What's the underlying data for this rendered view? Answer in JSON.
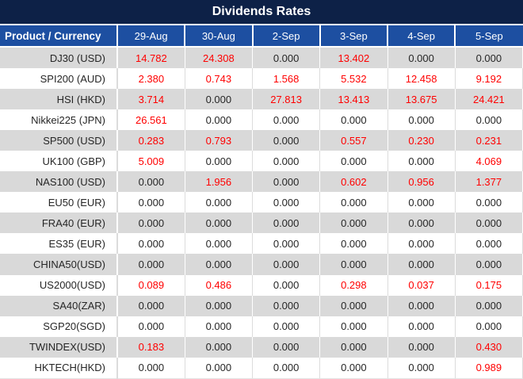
{
  "title": "Dividends Rates",
  "columns": [
    "Product / Currency",
    "29-Aug",
    "30-Aug",
    "2-Sep",
    "3-Sep",
    "4-Sep",
    "5-Sep"
  ],
  "rows": [
    {
      "product": "DJ30 (USD)",
      "values": [
        "14.782",
        "24.308",
        "0.000",
        "13.402",
        "0.000",
        "0.000"
      ]
    },
    {
      "product": "SPI200 (AUD)",
      "values": [
        "2.380",
        "0.743",
        "1.568",
        "5.532",
        "12.458",
        "9.192"
      ]
    },
    {
      "product": "HSI (HKD)",
      "values": [
        "3.714",
        "0.000",
        "27.813",
        "13.413",
        "13.675",
        "24.421"
      ]
    },
    {
      "product": "Nikkei225 (JPN)",
      "values": [
        "26.561",
        "0.000",
        "0.000",
        "0.000",
        "0.000",
        "0.000"
      ]
    },
    {
      "product": "SP500 (USD)",
      "values": [
        "0.283",
        "0.793",
        "0.000",
        "0.557",
        "0.230",
        "0.231"
      ]
    },
    {
      "product": "UK100 (GBP)",
      "values": [
        "5.009",
        "0.000",
        "0.000",
        "0.000",
        "0.000",
        "4.069"
      ]
    },
    {
      "product": "NAS100 (USD)",
      "values": [
        "0.000",
        "1.956",
        "0.000",
        "0.602",
        "0.956",
        "1.377"
      ]
    },
    {
      "product": "EU50 (EUR)",
      "values": [
        "0.000",
        "0.000",
        "0.000",
        "0.000",
        "0.000",
        "0.000"
      ]
    },
    {
      "product": "FRA40 (EUR)",
      "values": [
        "0.000",
        "0.000",
        "0.000",
        "0.000",
        "0.000",
        "0.000"
      ]
    },
    {
      "product": "ES35 (EUR)",
      "values": [
        "0.000",
        "0.000",
        "0.000",
        "0.000",
        "0.000",
        "0.000"
      ]
    },
    {
      "product": "CHINA50(USD)",
      "values": [
        "0.000",
        "0.000",
        "0.000",
        "0.000",
        "0.000",
        "0.000"
      ]
    },
    {
      "product": "US2000(USD)",
      "values": [
        "0.089",
        "0.486",
        "0.000",
        "0.298",
        "0.037",
        "0.175"
      ]
    },
    {
      "product": "SA40(ZAR)",
      "values": [
        "0.000",
        "0.000",
        "0.000",
        "0.000",
        "0.000",
        "0.000"
      ]
    },
    {
      "product": "SGP20(SGD)",
      "values": [
        "0.000",
        "0.000",
        "0.000",
        "0.000",
        "0.000",
        "0.000"
      ]
    },
    {
      "product": "TWINDEX(USD)",
      "values": [
        "0.183",
        "0.000",
        "0.000",
        "0.000",
        "0.000",
        "0.430"
      ]
    },
    {
      "product": "HKTECH(HKD)",
      "values": [
        "0.000",
        "0.000",
        "0.000",
        "0.000",
        "0.000",
        "0.989"
      ]
    }
  ],
  "colors": {
    "title_bg": "#0d2147",
    "header_bg": "#1d4fa1",
    "row_stripe": "#d9d9d9",
    "value_highlight": "#ff0000",
    "text_dark": "#262626",
    "header_text": "#ffffff"
  }
}
